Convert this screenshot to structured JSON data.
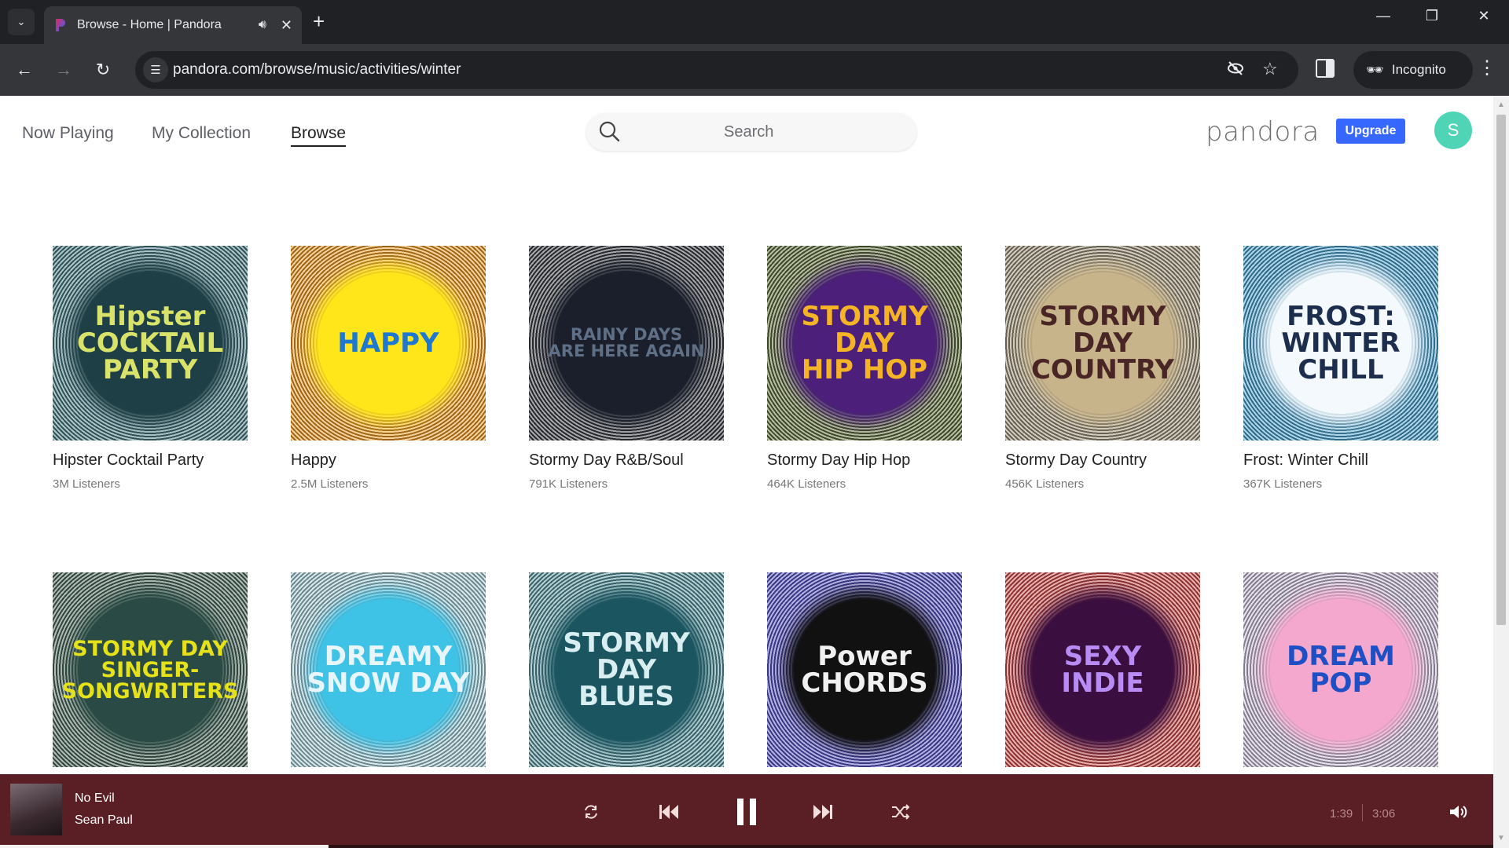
{
  "browser": {
    "tab_title": "Browse - Home | Pandora",
    "url": "pandora.com/browse/music/activities/winter",
    "incognito_label": "Incognito",
    "icons": {
      "tab_search": "chevron-down-icon",
      "audio": "speaker-icon",
      "close_tab": "close-icon",
      "new_tab": "plus-icon",
      "back": "arrow-left-icon",
      "forward": "arrow-right-icon",
      "reload": "reload-icon",
      "site_info": "tune-icon",
      "tracking": "eye-off-icon",
      "bookmark": "star-icon",
      "side_panel": "side-panel-icon",
      "menu": "more-vert-icon",
      "minimize": "minimize-icon",
      "restore": "restore-icon",
      "close_window": "close-icon"
    }
  },
  "header": {
    "nav": [
      {
        "label": "Now Playing",
        "active": false
      },
      {
        "label": "My Collection",
        "active": false
      },
      {
        "label": "Browse",
        "active": true
      }
    ],
    "search_placeholder": "Search",
    "logo": "pandora",
    "upgrade_label": "Upgrade",
    "avatar_initial": "S",
    "colors": {
      "upgrade": "#3668ff",
      "avatar": "#50d4b6"
    }
  },
  "stations": [
    {
      "title": "Hipster Cocktail Party",
      "listeners": "3M Listeners",
      "art_text": "Hipster\nCOCKTAIL\nPARTY",
      "ring": "#4a7d86",
      "circle": "#1d3f45",
      "text_color": "#d9e36a"
    },
    {
      "title": "Happy",
      "listeners": "2.5M Listeners",
      "art_text": "HAPPY",
      "ring": "#f29b24",
      "circle": "#ffe61a",
      "text_color": "#1e78d0"
    },
    {
      "title": "Stormy Day R&B/Soul",
      "listeners": "791K Listeners",
      "art_text": "RAINY DAYS\nARE HERE AGAIN",
      "ring": "#3a3d45",
      "circle": "#1a1f2b",
      "text_color": "#5f6f85"
    },
    {
      "title": "Stormy Day Hip Hop",
      "listeners": "464K Listeners",
      "art_text": "STORMY\nDAY\nHIP HOP",
      "ring": "#5f6e3a",
      "circle": "#4b1f7a",
      "text_color": "#f5b326"
    },
    {
      "title": "Stormy Day Country",
      "listeners": "456K Listeners",
      "art_text": "STORMY\nDAY\nCOUNTRY",
      "ring": "#9c9078",
      "circle": "#c8b48a",
      "text_color": "#4a2525"
    },
    {
      "title": "Frost: Winter Chill",
      "listeners": "367K Listeners",
      "art_text": "FROST:\nWINTER\nCHILL",
      "ring": "#4aa3d1",
      "circle": "#f4f9fd",
      "text_color": "#1c2d4d"
    },
    {
      "title": "Stormy Day Singer-Songwriters",
      "listeners": "",
      "art_text": "STORMY DAY\nSINGER-\nSONGWRITERS",
      "ring": "#4e6b5e",
      "circle": "#2a4b45",
      "text_color": "#e6e21a"
    },
    {
      "title": "Dreamy Snow Day",
      "listeners": "",
      "art_text": "DREAMY\nSNOW DAY",
      "ring": "#a8cfd8",
      "circle": "#3ec2e6",
      "text_color": "#e8f6fb"
    },
    {
      "title": "Stormy Day Blues",
      "listeners": "",
      "art_text": "STORMY\nDAY\nBLUES",
      "ring": "#5a98a2",
      "circle": "#1a5560",
      "text_color": "#d8eef0"
    },
    {
      "title": "Power Chords",
      "listeners": "",
      "art_text": "Power\nCHORDS",
      "ring": "#5a56c8",
      "circle": "#111111",
      "text_color": "#f0f0f0"
    },
    {
      "title": "Sexy Indie",
      "listeners": "",
      "art_text": "SEXY\nINDIE",
      "ring": "#d2504e",
      "circle": "#3a0f3f",
      "text_color": "#b98cf5"
    },
    {
      "title": "Dream Pop",
      "listeners": "",
      "art_text": "DREAM\nPOP",
      "ring": "#c9bfd9",
      "circle": "#f4a8cd",
      "text_color": "#1f4fc4"
    }
  ],
  "player": {
    "track_title": "No Evil",
    "artist": "Sean Paul",
    "elapsed": "1:39",
    "duration": "3:06",
    "progress_fraction": 0.22,
    "background": "#5a1f24",
    "icons": [
      "replay-icon",
      "skip-back-icon",
      "pause-icon",
      "skip-forward-icon",
      "shuffle-icon",
      "volume-icon"
    ]
  }
}
